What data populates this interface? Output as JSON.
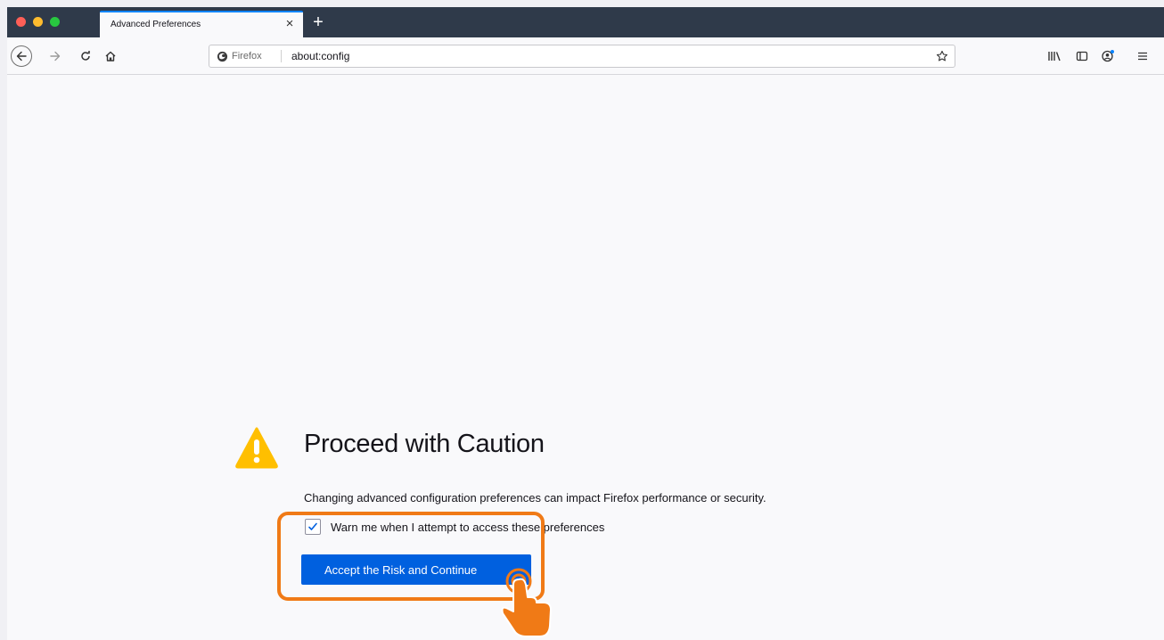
{
  "window": {
    "tab_title": "Advanced Preferences",
    "tab_close_label": "×",
    "new_tab_label": "+"
  },
  "navbar": {
    "identity_label": "Firefox",
    "url": "about:config"
  },
  "content": {
    "title": "Proceed with Caution",
    "description": "Changing advanced configuration preferences can impact Firefox performance or security.",
    "checkbox_label": "Warn me when I attempt to access these preferences",
    "checkbox_checked": true,
    "accept_button": "Accept the Risk and Continue"
  },
  "colors": {
    "accent": "#0060df",
    "highlight": "#f07a16",
    "warning": "#ffbf00"
  },
  "icons": {
    "back": "arrow-left-icon",
    "forward": "arrow-right-icon",
    "reload": "reload-icon",
    "home": "home-icon",
    "bookmark": "star-icon",
    "library": "library-icon",
    "sidebar": "sidebar-icon",
    "account": "account-icon",
    "menu": "hamburger-menu-icon",
    "warning": "warning-triangle-icon"
  }
}
